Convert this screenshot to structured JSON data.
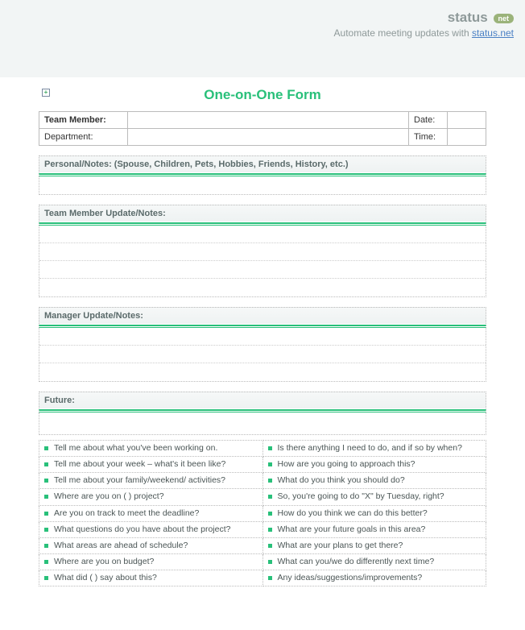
{
  "header": {
    "logo_text": "status",
    "logo_badge": "net",
    "tagline_prefix": "Automate meeting updates with ",
    "tagline_link": "status.net"
  },
  "title": "One-on-One  Form",
  "meta": {
    "team_member_label": "Team Member:",
    "team_member_value": "",
    "date_label": "Date:",
    "date_value": "",
    "department_label": "Department:",
    "department_value": "",
    "time_label": "Time:",
    "time_value": ""
  },
  "sections": {
    "personal": "Personal/Notes: (Spouse, Children, Pets, Hobbies, Friends, History, etc.)",
    "team_update": "Team Member Update/Notes:",
    "manager_update": "Manager Update/Notes:",
    "future": "Future:"
  },
  "questions_left": [
    "Tell me about what you've been working on.",
    "Tell me about your week – what's it been like?",
    "Tell me about your family/weekend/ activities?",
    "Where are you on (     ) project?",
    "Are you on track to meet the deadline?",
    "What questions do you have about the project?",
    "What areas are ahead of schedule?",
    "Where are you on budget?",
    "What did (     ) say about this?"
  ],
  "questions_right": [
    "Is there anything I need to do, and if so by when?",
    "How are you going to approach this?",
    "What do you think you should do?",
    "So, you're going to do \"X\" by Tuesday, right?",
    "How do you think we can do this better?",
    "What are your future goals in this area?",
    "What are your plans to get there?",
    "What can you/we do differently next time?",
    "Any ideas/suggestions/improvements?"
  ]
}
